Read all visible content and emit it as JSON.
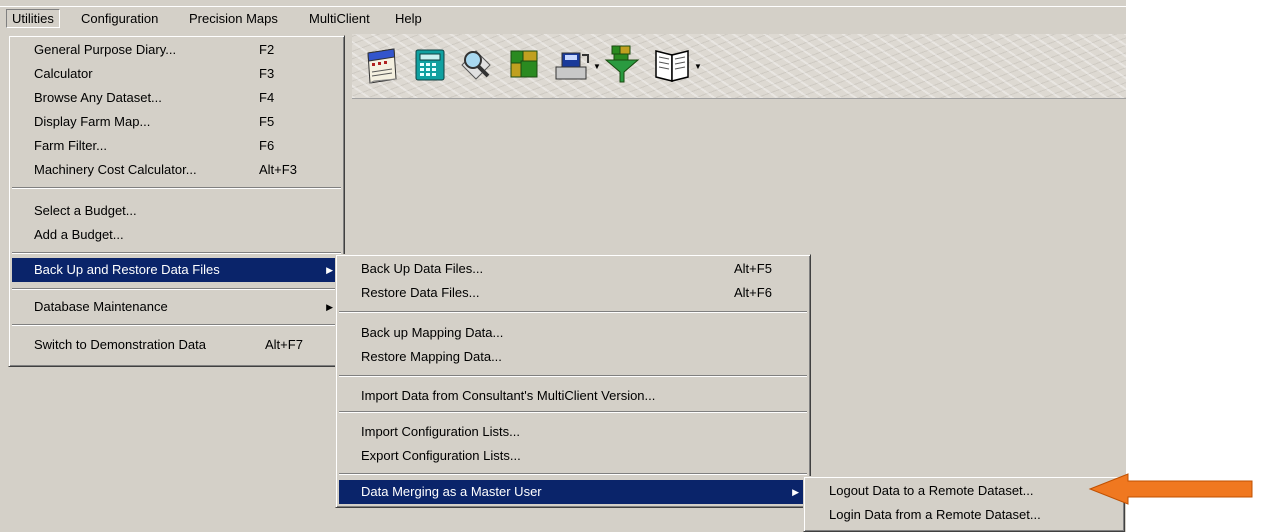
{
  "menubar": {
    "items": [
      "Utilities",
      "Configuration",
      "Precision Maps",
      "MultiClient",
      "Help"
    ]
  },
  "toolbar": {
    "buttons": [
      "diary-icon",
      "calculator-icon",
      "browse-dataset-icon",
      "farm-map-icon",
      "transfer-icon",
      "farm-filter-icon",
      "book-icon"
    ]
  },
  "utilities_menu": {
    "items": [
      {
        "label": "General Purpose Diary...",
        "shortcut": "F2"
      },
      {
        "label": "Calculator",
        "shortcut": "F3"
      },
      {
        "label": "Browse Any Dataset...",
        "shortcut": "F4"
      },
      {
        "label": "Display Farm Map...",
        "shortcut": "F5"
      },
      {
        "label": "Farm Filter...",
        "shortcut": "F6"
      },
      {
        "label": "Machinery Cost Calculator...",
        "shortcut": "Alt+F3"
      },
      {
        "label": "Select a Budget..."
      },
      {
        "label": "Add a Budget..."
      },
      {
        "label": "Back Up and Restore Data Files"
      },
      {
        "label": "Database Maintenance"
      },
      {
        "label": "Switch to Demonstration Data",
        "shortcut": "Alt+F7"
      }
    ]
  },
  "backup_menu": {
    "items": [
      {
        "label": "Back Up Data Files...",
        "shortcut": "Alt+F5"
      },
      {
        "label": "Restore Data Files...",
        "shortcut": "Alt+F6"
      },
      {
        "label": "Back up Mapping Data..."
      },
      {
        "label": "Restore Mapping Data..."
      },
      {
        "label": "Import Data from Consultant's MultiClient Version..."
      },
      {
        "label": "Import Configuration Lists..."
      },
      {
        "label": "Export Configuration Lists..."
      },
      {
        "label": "Data Merging as a Master User"
      }
    ]
  },
  "merge_menu": {
    "items": [
      {
        "label": "Logout Data to a Remote Dataset..."
      },
      {
        "label": "Login Data from a Remote Dataset..."
      }
    ]
  },
  "colors": {
    "selection": "#0a246a",
    "callout_arrow": "#f07820"
  }
}
